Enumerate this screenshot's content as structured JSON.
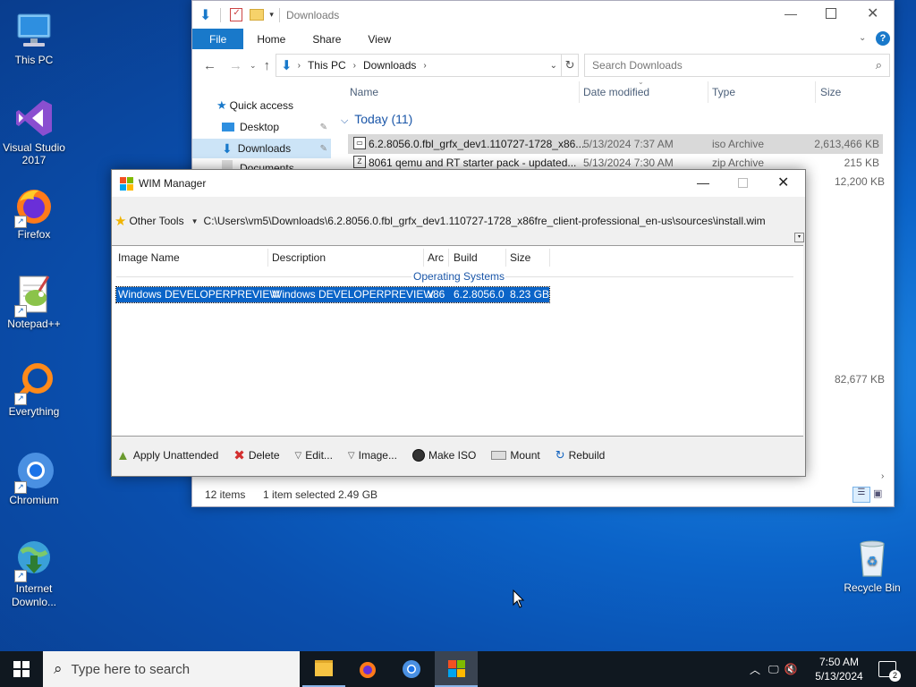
{
  "desktop": {
    "icons": [
      {
        "label": "This PC"
      },
      {
        "label": "Visual Studio 2017"
      },
      {
        "label": "Firefox"
      },
      {
        "label": "Notepad++"
      },
      {
        "label": "Everything"
      },
      {
        "label": "Chromium"
      },
      {
        "label": "Internet Downlo..."
      },
      {
        "label": "Recycle Bin"
      }
    ]
  },
  "explorer": {
    "title": "Downloads",
    "ribbon_tabs": [
      "File",
      "Home",
      "Share",
      "View"
    ],
    "breadcrumb": [
      "This PC",
      "Downloads"
    ],
    "search_placeholder": "Search Downloads",
    "columns": {
      "name": "Name",
      "date": "Date modified",
      "type": "Type",
      "size": "Size"
    },
    "nav": {
      "quick_access": "Quick access",
      "desktop": "Desktop",
      "downloads": "Downloads",
      "documents": "Documents"
    },
    "group_label": "Today (11)",
    "files": [
      {
        "name": "6.2.8056.0.fbl_grfx_dev1.110727-1728_x86...",
        "date": "5/13/2024 7:37 AM",
        "type": "iso Archive",
        "size": "2,613,466 KB"
      },
      {
        "name": "8061 qemu and RT starter pack - updated...",
        "date": "5/13/2024 7:30 AM",
        "type": "zip Archive",
        "size": "215 KB"
      }
    ],
    "extra_sizes": [
      "12,200 KB",
      "82,677 KB"
    ],
    "status": {
      "items": "12 items",
      "selected": "1 item selected",
      "size": "2.49 GB"
    }
  },
  "wim": {
    "title": "WIM Manager",
    "other_tools": "Other Tools",
    "path": "C:\\Users\\vm5\\Downloads\\6.2.8056.0.fbl_grfx_dev1.110727-1728_x86fre_client-professional_en-us\\sources\\install.wim",
    "columns": {
      "image_name": "Image Name",
      "description": "Description",
      "arc": "Arc",
      "build": "Build",
      "size": "Size"
    },
    "group": "Operating Systems",
    "row": {
      "image_name": "Windows DEVELOPERPREVIEW",
      "description": "Windows DEVELOPERPREVIEW",
      "arc": "x86",
      "build": "6.2.8056.0",
      "size": "8.23 GB"
    },
    "actions": [
      "Apply Unattended",
      "Delete",
      "Edit...",
      "Image...",
      "Make ISO",
      "Mount",
      "Rebuild"
    ]
  },
  "taskbar": {
    "search_placeholder": "Type here to search",
    "time": "7:50 AM",
    "date": "5/13/2024",
    "notifications": "2"
  },
  "colors": {
    "accent": "#1979ca",
    "selection": "#0a64c8",
    "desktop": "#0b63c8"
  }
}
